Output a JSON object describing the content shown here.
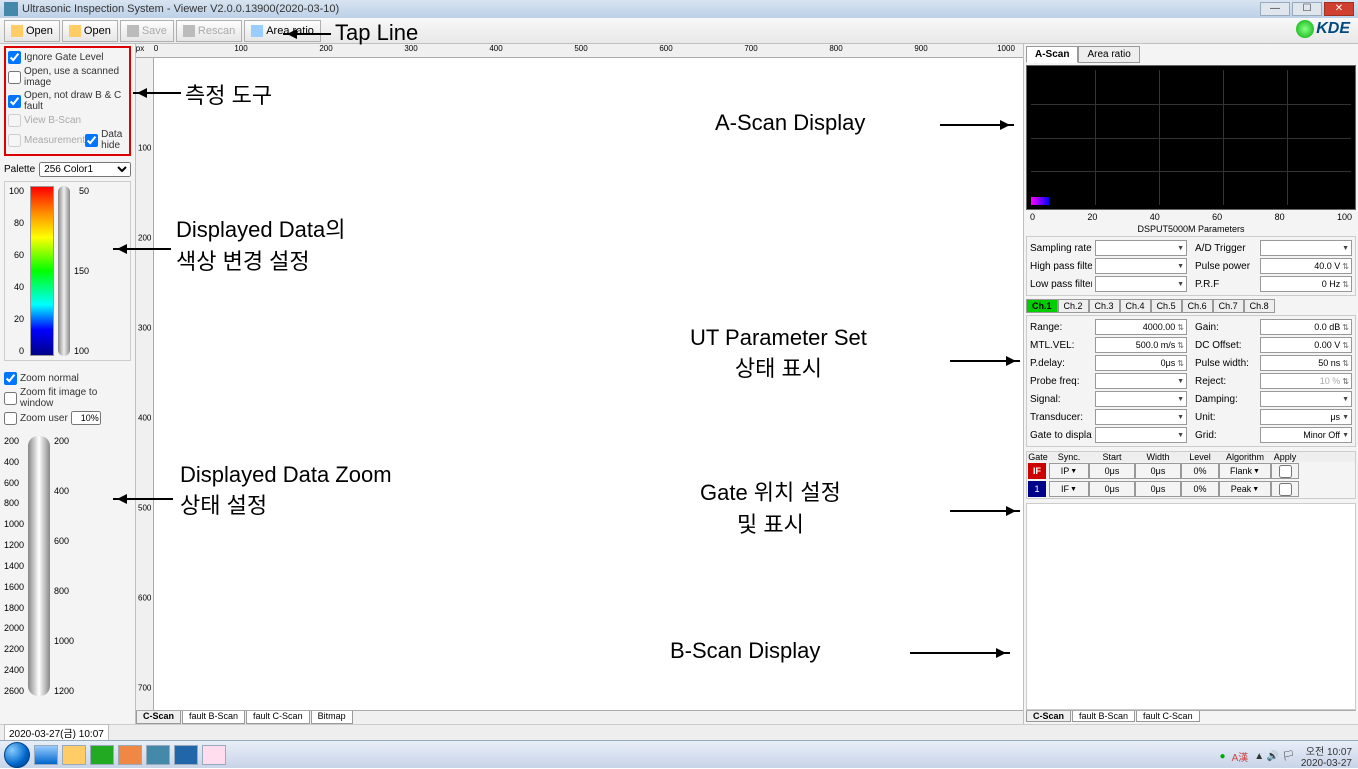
{
  "title": "Ultrasonic Inspection System - Viewer V2.0.0.13900(2020-03-10)",
  "toolbar": {
    "open1": "Open",
    "open2": "Open",
    "save": "Save",
    "rescan": "Rescan",
    "arearatio": "Area ratio"
  },
  "logo": "KDE",
  "left": {
    "ignore_gate": "Ignore Gate Level",
    "open_scanned": "Open, use a scanned image",
    "open_notdraw": "Open, not draw B & C fault",
    "view_bscan": "View B-Scan",
    "measurement": "Measurement",
    "datahide": "Data hide",
    "palette_label": "Palette",
    "palette_value": "256 Color1",
    "scale_labels": [
      "100",
      "80",
      "60",
      "40",
      "20",
      "0"
    ],
    "cyl_labels": [
      "50",
      "150",
      "100"
    ],
    "zoom_normal": "Zoom normal",
    "zoom_fit": "Zoom fit image to window",
    "zoom_user": "Zoom user",
    "zoom_user_val": "10%",
    "big_scale": [
      "200",
      "400",
      "600",
      "800",
      "1000",
      "1200",
      "1400",
      "1600",
      "1800",
      "2000",
      "2200",
      "2400",
      "2600"
    ],
    "big_scale2": [
      "200",
      "400",
      "600",
      "800",
      "1000",
      "1200"
    ]
  },
  "center": {
    "ruler_marks": [
      "0",
      "100",
      "200",
      "300",
      "400",
      "500",
      "600",
      "700",
      "800",
      "900",
      "1000"
    ],
    "px_label": "px",
    "vruler_marks": [
      "100",
      "200",
      "300",
      "400",
      "500",
      "600",
      "700"
    ],
    "tabs": [
      "C-Scan",
      "fault B-Scan",
      "fault C-Scan",
      "Bitmap"
    ]
  },
  "right": {
    "tabs": [
      "A-Scan",
      "Area ratio"
    ],
    "ascan_x": [
      "0",
      "20",
      "40",
      "60",
      "80",
      "100"
    ],
    "ascan_title": "DSPUT5000M Parameters",
    "params": {
      "sampling_rate": "Sampling rate",
      "ad_trigger": "A/D Trigger",
      "high_pass": "High pass filter",
      "pulse_power": "Pulse power",
      "pulse_power_val": "40.0 V",
      "low_pass": "Low pass filter",
      "prf": "P.R.F",
      "prf_val": "0 Hz"
    },
    "ch_tabs": [
      "Ch.1",
      "Ch.2",
      "Ch.3",
      "Ch.4",
      "Ch.5",
      "Ch.6",
      "Ch.7",
      "Ch.8"
    ],
    "ch_params": {
      "range": "Range:",
      "range_val": "4000.00",
      "gain": "Gain:",
      "gain_val": "0.0 dB",
      "mtlvel": "MTL.VEL:",
      "mtlvel_val": "500.0 m/s",
      "dcoffset": "DC Offset:",
      "dcoffset_val": "0.00 V",
      "pdelay": "P.delay:",
      "pdelay_val": "0μs",
      "pulsewidth": "Pulse width:",
      "pulsewidth_val": "50 ns",
      "probefreq": "Probe freq:",
      "reject": "Reject:",
      "reject_val": "10 %",
      "signal": "Signal:",
      "damping": "Damping:",
      "transducer": "Transducer:",
      "unit": "Unit:",
      "unit_val": "μs",
      "gatedisplay": "Gate to display:",
      "grid": "Grid:",
      "grid_val": "Minor Off"
    },
    "gate_hdr": [
      "Gate",
      "Sync.",
      "Start",
      "Width",
      "Level",
      "Algorithm",
      "Apply"
    ],
    "gate1": {
      "tag": "IF",
      "sync": "IP",
      "start": "0μs",
      "width": "0μs",
      "level": "0%",
      "algo": "Flank"
    },
    "gate2": {
      "tag": "1",
      "sync": "IF",
      "start": "0μs",
      "width": "0μs",
      "level": "0%",
      "algo": "Peak"
    },
    "btabs": [
      "C-Scan",
      "fault B-Scan",
      "fault C-Scan"
    ]
  },
  "annotations": {
    "tapline": "Tap Line",
    "measure": "측정 도구",
    "color": "Displayed Data의\n색상 변경 설정",
    "zoom": "Displayed Data Zoom\n상태 설정",
    "ascan": "A-Scan Display",
    "utparam": "UT Parameter Set\n상태 표시",
    "gate": "Gate 위치 설정\n및 표시",
    "bscan": "B-Scan Display"
  },
  "status": {
    "datetime": "2020-03-27(금) 10:07"
  },
  "tray": {
    "ime": "A漢",
    "time": "오전 10:07",
    "date": "2020-03-27"
  }
}
